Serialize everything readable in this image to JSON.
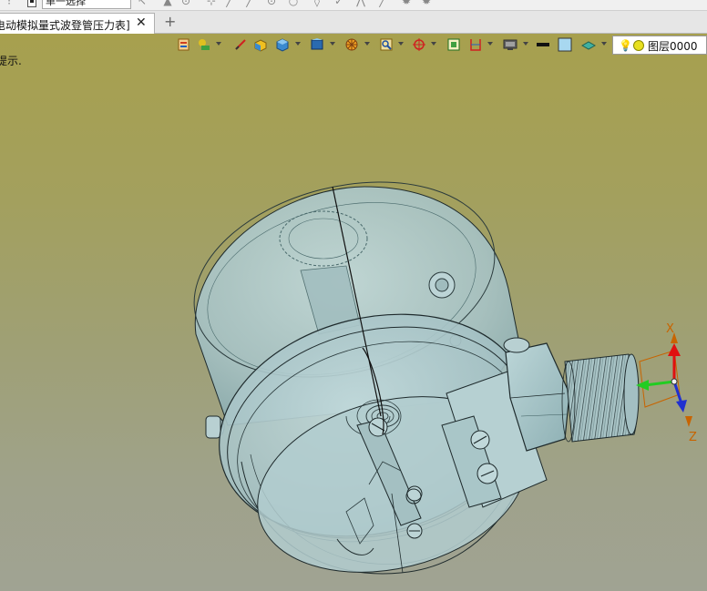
{
  "toolbar": {
    "selection_mode": "单一选择"
  },
  "tabs": [
    {
      "title": "电动模拟量式波登管压力表]",
      "close": "✕"
    }
  ],
  "tab_add": "+",
  "viewport": {
    "hint_text": "提示.",
    "layer": {
      "name": "图层0000"
    }
  },
  "triad": {
    "x_label": "X",
    "y_label": "Y",
    "z_label": "Z"
  },
  "colors": {
    "viewport_top": "#a7a04e",
    "viewport_bottom": "#a0a393",
    "model_fill": "#a9c6c8",
    "axis_x": "#e01010",
    "axis_y": "#22cc22",
    "axis_z": "#2030d0",
    "triad_label": "#c86400"
  }
}
